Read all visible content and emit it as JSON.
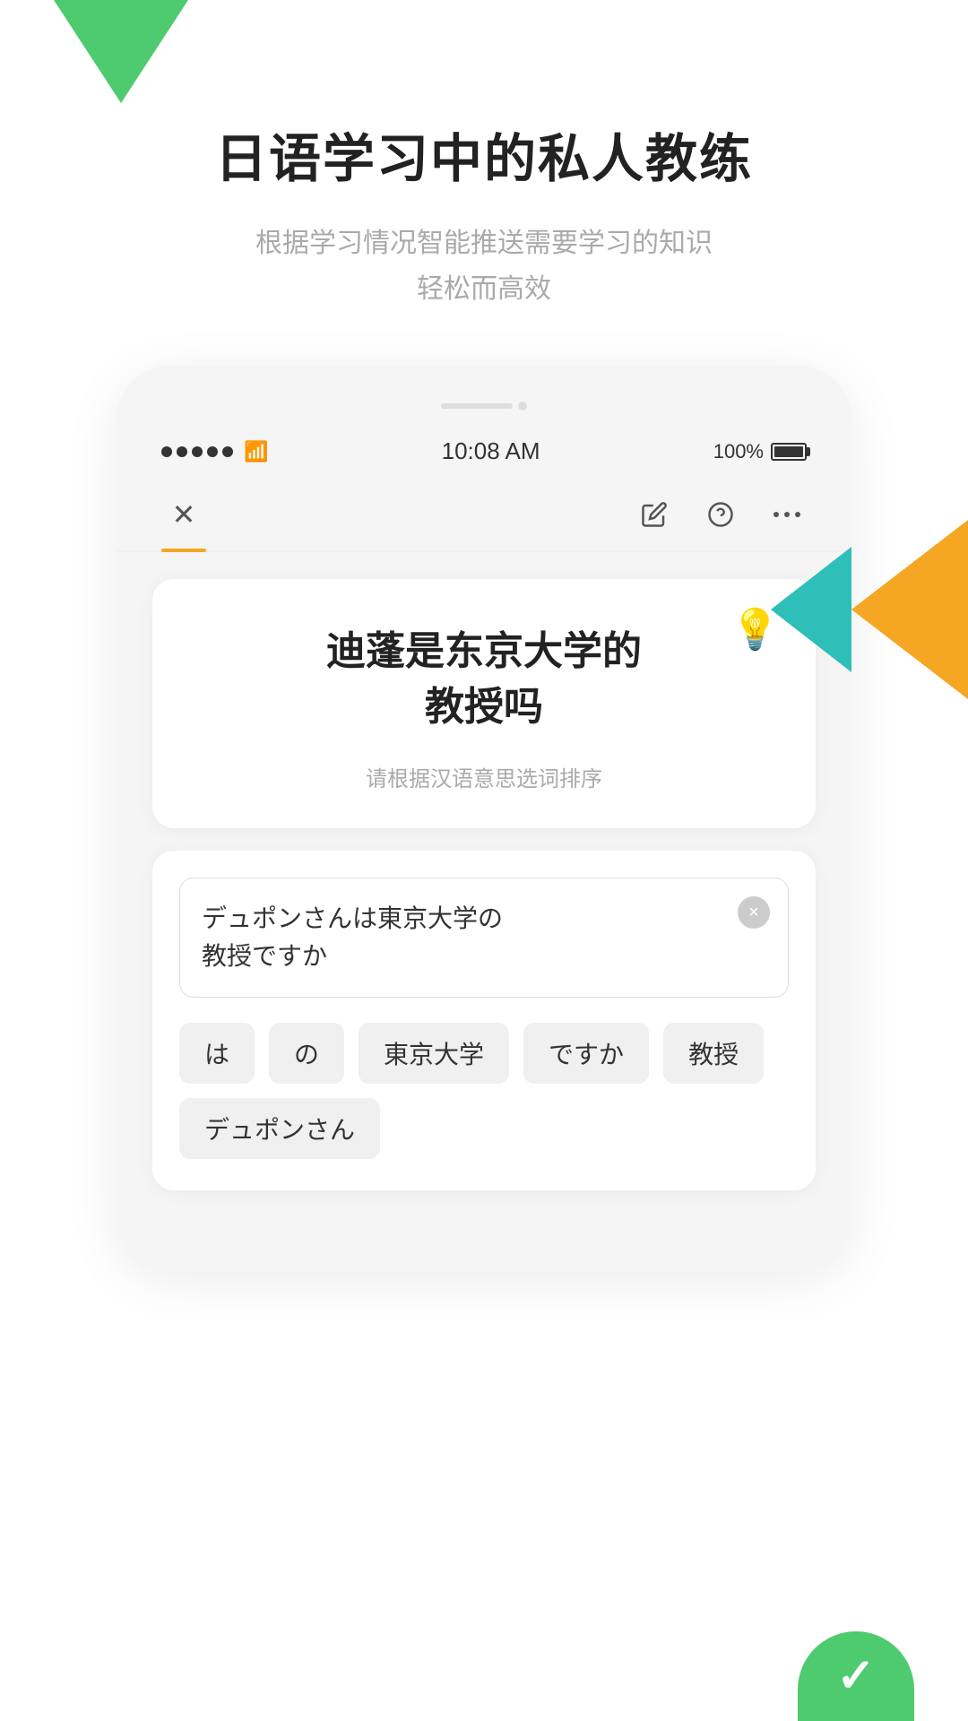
{
  "page": {
    "title": "日语学习中的私人教练",
    "subtitle": "根据学习情况智能推送需要学习的知识\n轻松而高效"
  },
  "status_bar": {
    "time": "10:08 AM",
    "battery": "100%"
  },
  "toolbar": {
    "close_icon": "✕",
    "edit_icon": "📝",
    "help_icon": "?",
    "more_icon": "···"
  },
  "question_card": {
    "hint_icon": "💡",
    "question_text": "迪蓬是东京大学的\n教授吗",
    "hint_text": "请根据汉语意思选词排序"
  },
  "answer_card": {
    "input_text": "デュポンさんは東京大学の\n教授ですか",
    "clear_icon": "×",
    "word_tiles": [
      {
        "text": "は"
      },
      {
        "text": "の"
      },
      {
        "text": "東京大学"
      },
      {
        "text": "ですか"
      },
      {
        "text": "教授"
      },
      {
        "text": "デュポンさん"
      }
    ]
  }
}
